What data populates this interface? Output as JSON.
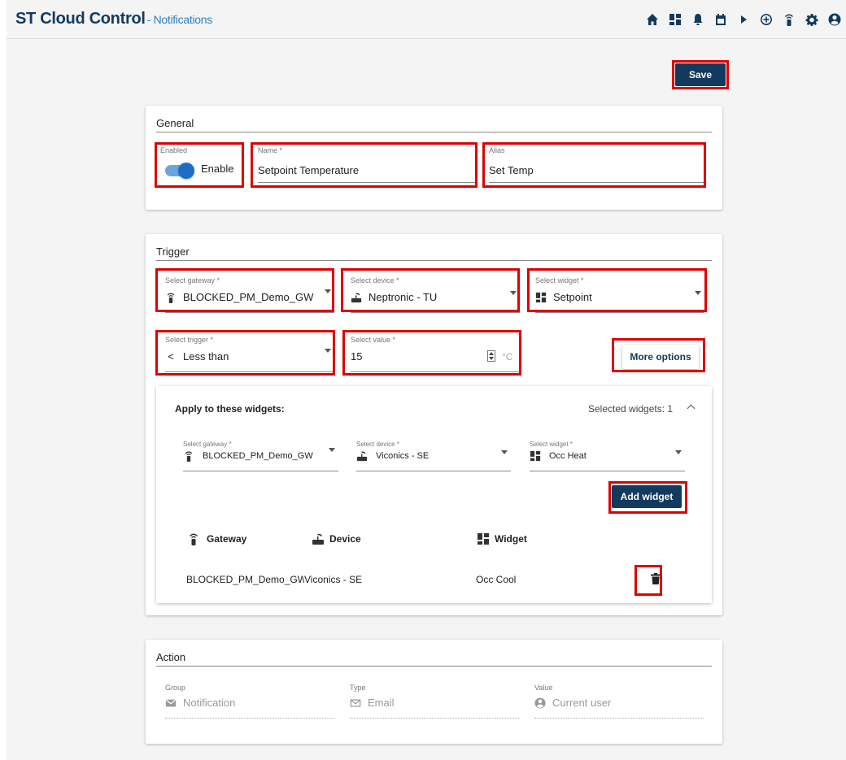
{
  "app": {
    "title": "ST Cloud Control",
    "subtitle": "- Notifications"
  },
  "nav_icons": [
    "home-icon",
    "dashboard-icon",
    "bell-icon",
    "calendar-icon",
    "play-icon",
    "add-circle-icon",
    "gateway-icon",
    "gear-icon",
    "account-icon"
  ],
  "toolbar": {
    "save_label": "Save"
  },
  "general": {
    "title": "General",
    "enabled_label": "Enabled",
    "enabled_text": "Enable",
    "enabled_state": true,
    "name_label": "Name *",
    "name_value": "Setpoint Temperature",
    "alias_label": "Alias",
    "alias_value": "Set Temp"
  },
  "trigger": {
    "title": "Trigger",
    "gateway_label": "Select gateway *",
    "gateway_value": "BLOCKED_PM_Demo_GW",
    "device_label": "Select device *",
    "device_value": "Neptronic - TU",
    "widget_label": "Select widget *",
    "widget_value": "Setpoint",
    "trigger_label": "Select trigger *",
    "trigger_symbol": "<",
    "trigger_value": "Less than",
    "value_label": "Select value *",
    "value_value": "15",
    "value_unit": "°C",
    "more_options_label": "More options"
  },
  "apply": {
    "title": "Apply to these widgets:",
    "selected_text": "Selected widgets: 1",
    "gateway_label": "Select gateway *",
    "gateway_value": "BLOCKED_PM_Demo_GW",
    "device_label": "Select device *",
    "device_value": "Viconics - SE",
    "widget_label": "Select widget *",
    "widget_value": "Occ Heat",
    "add_widget_label": "Add widget",
    "table_headers": {
      "gateway": "Gateway",
      "device": "Device",
      "widget": "Widget"
    },
    "rows": [
      {
        "gateway": "BLOCKED_PM_Demo_GW",
        "device": "Viconics - SE",
        "widget": "Occ Cool"
      }
    ]
  },
  "action": {
    "title": "Action",
    "group_label": "Group",
    "group_value": "Notification",
    "type_label": "Type",
    "type_value": "Email",
    "value_label": "Value",
    "value_value": "Current user"
  },
  "colors": {
    "brand": "#123a5e",
    "accent": "#2f7fc1",
    "highlight": "#e00000",
    "toggle": "#1a6fc4"
  }
}
